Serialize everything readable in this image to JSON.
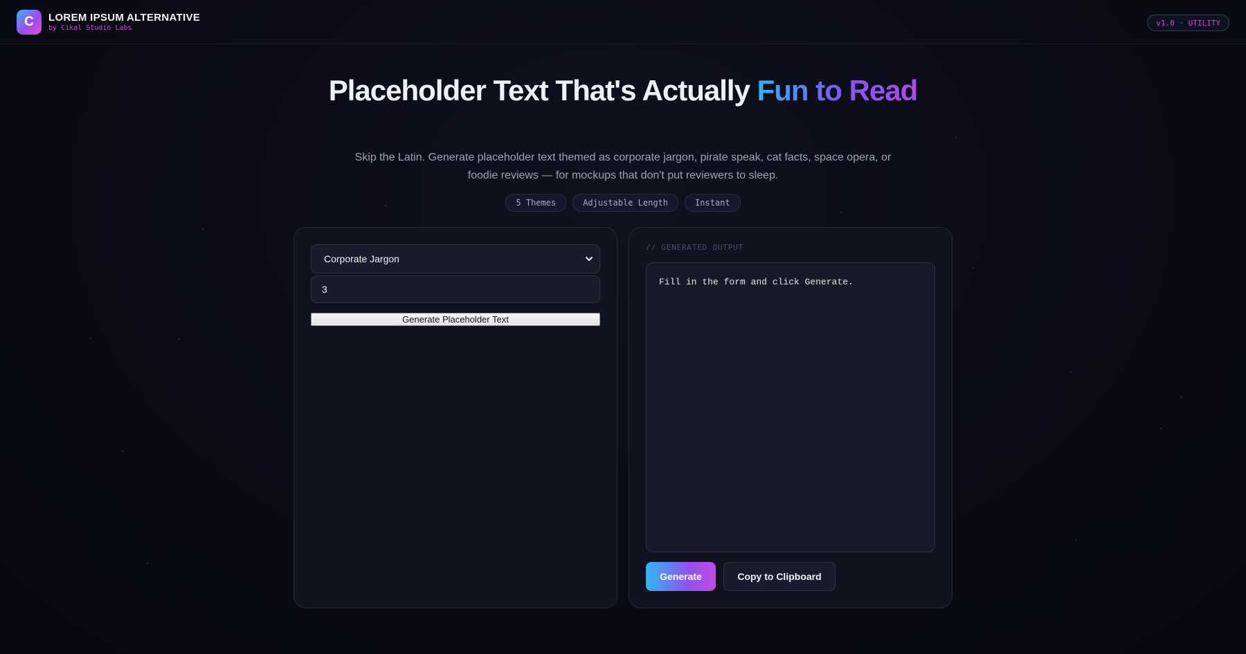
{
  "header": {
    "logo_letter": "C",
    "title": "LOREM IPSUM ALTERNATIVE",
    "subtitle": "by Cikal Studio Labs",
    "version_badge": "v1.0 · UTILITY"
  },
  "hero": {
    "title_plain": "Placeholder Text That's Actually ",
    "title_accent": "Fun to Read",
    "description": "Skip the Latin. Generate placeholder text themed as corporate jargon, pirate speak, cat facts, space opera, or foodie reviews — for mockups that don't put reviewers to sleep.",
    "chips": [
      "5 Themes",
      "Adjustable Length",
      "Instant"
    ]
  },
  "form": {
    "theme_selected": "Corporate Jargon",
    "length_value": "3",
    "generate_label": "Generate Placeholder Text"
  },
  "output": {
    "label": "// GENERATED OUTPUT",
    "text": "Fill in the form and click Generate.",
    "generate_button": "Generate",
    "copy_button": "Copy to Clipboard"
  },
  "colors": {
    "background": "#090a14",
    "accent_blue": "#2fb6f4",
    "accent_purple": "#8f52f0",
    "accent_pink": "#d24ae0"
  }
}
